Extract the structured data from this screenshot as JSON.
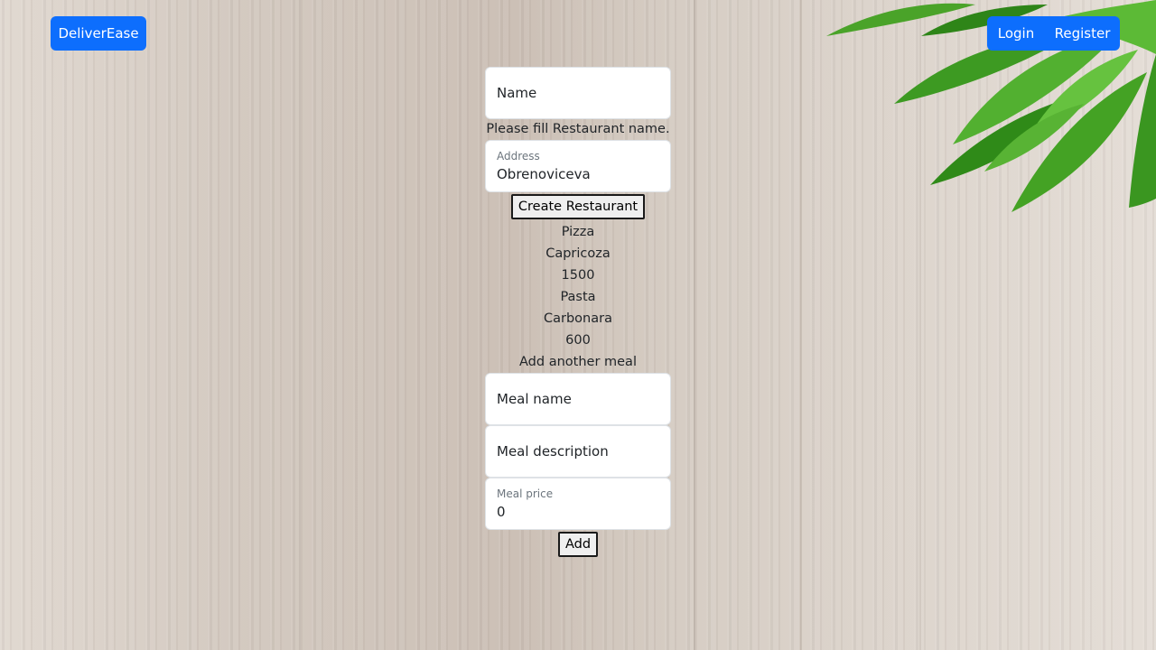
{
  "nav": {
    "brand": "DeliverEase",
    "login": "Login",
    "register": "Register"
  },
  "restaurant_form": {
    "name_placeholder": "Name",
    "name_helper": "Please fill Restaurant name.",
    "address_label": "Address",
    "address_value": "Obrenoviceva",
    "create_button": "Create Restaurant"
  },
  "meals": [
    {
      "name": "Pizza",
      "description": "Capricoza",
      "price": "1500"
    },
    {
      "name": "Pasta",
      "description": "Carbonara",
      "price": "600"
    }
  ],
  "meal_form": {
    "heading": "Add another meal",
    "meal_name_placeholder": "Meal name",
    "meal_description_placeholder": "Meal description",
    "meal_price_label": "Meal price",
    "meal_price_value": "0",
    "add_button": "Add"
  },
  "colors": {
    "primary": "#0d6efd",
    "background": "#d8cfc6",
    "leaf": "#3f9a1f"
  }
}
